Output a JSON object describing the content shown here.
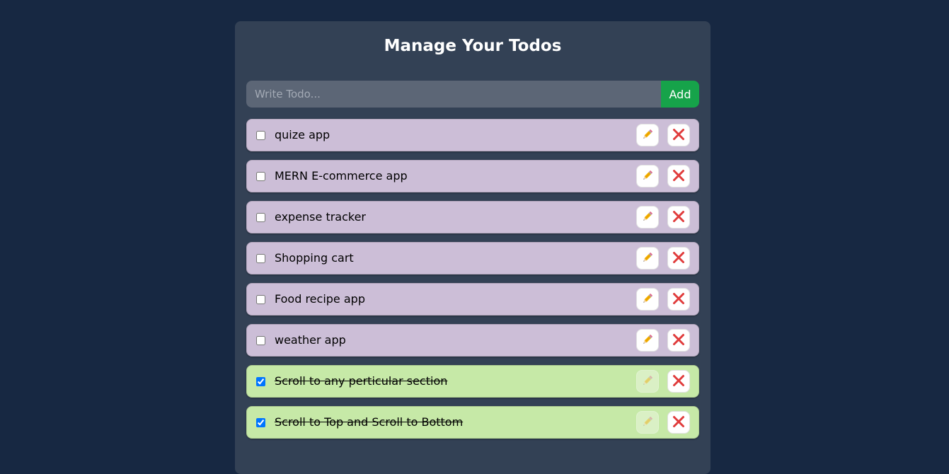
{
  "app": {
    "title": "Manage Your Todos"
  },
  "form": {
    "placeholder": "Write Todo...",
    "value": "",
    "add_label": "Add"
  },
  "icons": {
    "edit": "pencil-icon",
    "delete": "cross-icon"
  },
  "colors": {
    "background": "#172842",
    "card": "#334155",
    "pending_item": "#ccbed7",
    "completed_item": "#c6e9a7",
    "add_button": "#16a34a",
    "delete_icon": "#e03b3b"
  },
  "todos": [
    {
      "text": "quize app",
      "completed": false
    },
    {
      "text": "MERN E-commerce app",
      "completed": false
    },
    {
      "text": "expense tracker",
      "completed": false
    },
    {
      "text": "Shopping cart",
      "completed": false
    },
    {
      "text": "Food recipe app",
      "completed": false
    },
    {
      "text": "weather app",
      "completed": false
    },
    {
      "text": "Scroll to any perticular section",
      "completed": true
    },
    {
      "text": "Scroll to Top and Scroll to Bottom",
      "completed": true
    }
  ]
}
